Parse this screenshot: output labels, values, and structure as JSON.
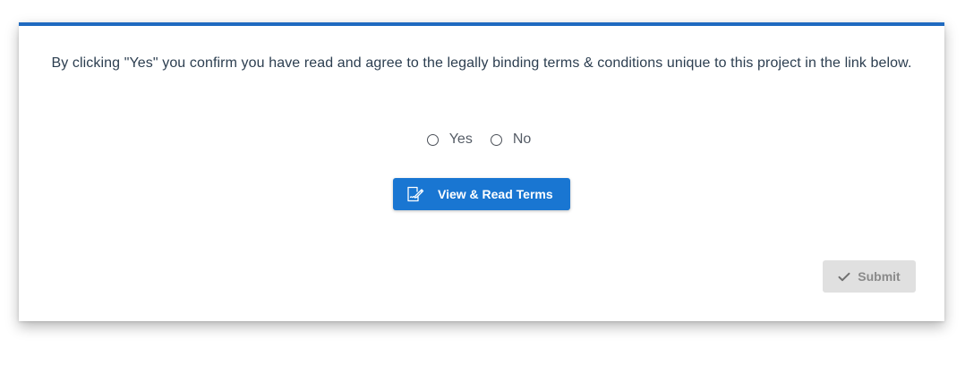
{
  "consent": {
    "message": "By clicking \"Yes\" you confirm you have read and agree to the legally binding terms & conditions unique to this project in the link below.",
    "options": [
      {
        "label": "Yes",
        "selected": false
      },
      {
        "label": "No",
        "selected": false
      }
    ]
  },
  "terms_button": {
    "label": "View & Read Terms",
    "icon": "document-edit-icon"
  },
  "submit_button": {
    "label": "Submit",
    "icon": "check-icon",
    "enabled": false
  },
  "colors": {
    "accent": "#1f6ac0",
    "button_primary": "#1976d2",
    "button_disabled": "#e0e0e0",
    "text": "#2c3e50"
  }
}
